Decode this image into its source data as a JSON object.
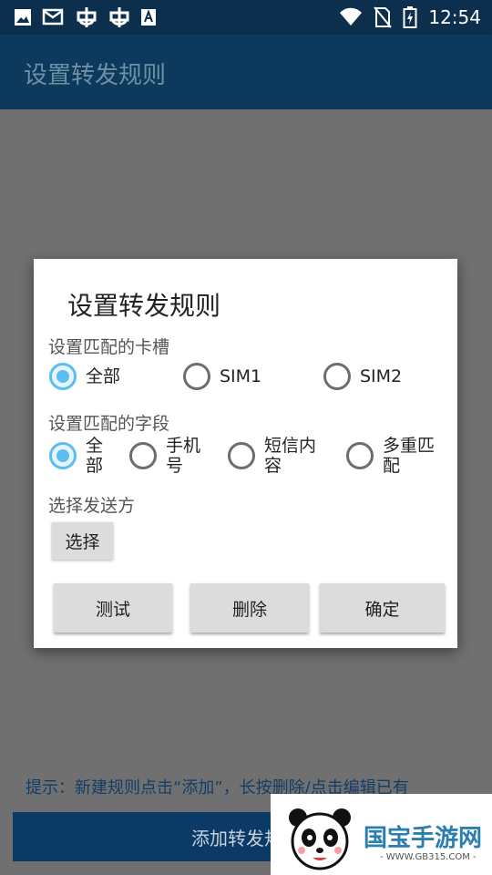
{
  "status_bar": {
    "time": "12:54",
    "left_icons": [
      "image-icon",
      "mail-icon",
      "bug-icon",
      "bug-icon",
      "a-icon"
    ],
    "right_icons": [
      "wifi-icon",
      "no-sim-icon",
      "battery-icon"
    ]
  },
  "app_bar": {
    "title": "设置转发规则"
  },
  "dialog": {
    "title": "设置转发规则",
    "sim_section": {
      "label": "设置匹配的卡槽",
      "options": [
        {
          "label": "全部",
          "checked": true
        },
        {
          "label": "SIM1",
          "checked": false
        },
        {
          "label": "SIM2",
          "checked": false
        }
      ]
    },
    "field_section": {
      "label": "设置匹配的字段",
      "options": [
        {
          "label": "全部",
          "checked": true
        },
        {
          "label": "手机号",
          "checked": false
        },
        {
          "label": "短信内容",
          "checked": false
        },
        {
          "label": "多重匹配",
          "checked": false
        }
      ]
    },
    "sender_section": {
      "label": "选择发送方",
      "select_button": "选择"
    },
    "buttons": {
      "test": "测试",
      "delete": "删除",
      "confirm": "确定"
    }
  },
  "main": {
    "hint": "提示：新建规则点击“添加”，长按删除/点击编辑已有",
    "add_button": "添加转发规则"
  },
  "watermark": {
    "text": "国宝手游网",
    "url": "- WWW.GB315.COM -"
  },
  "colors": {
    "primary_dark": "#0b2f4c",
    "primary": "#0d3a5c",
    "accent": "#5bbef0"
  }
}
